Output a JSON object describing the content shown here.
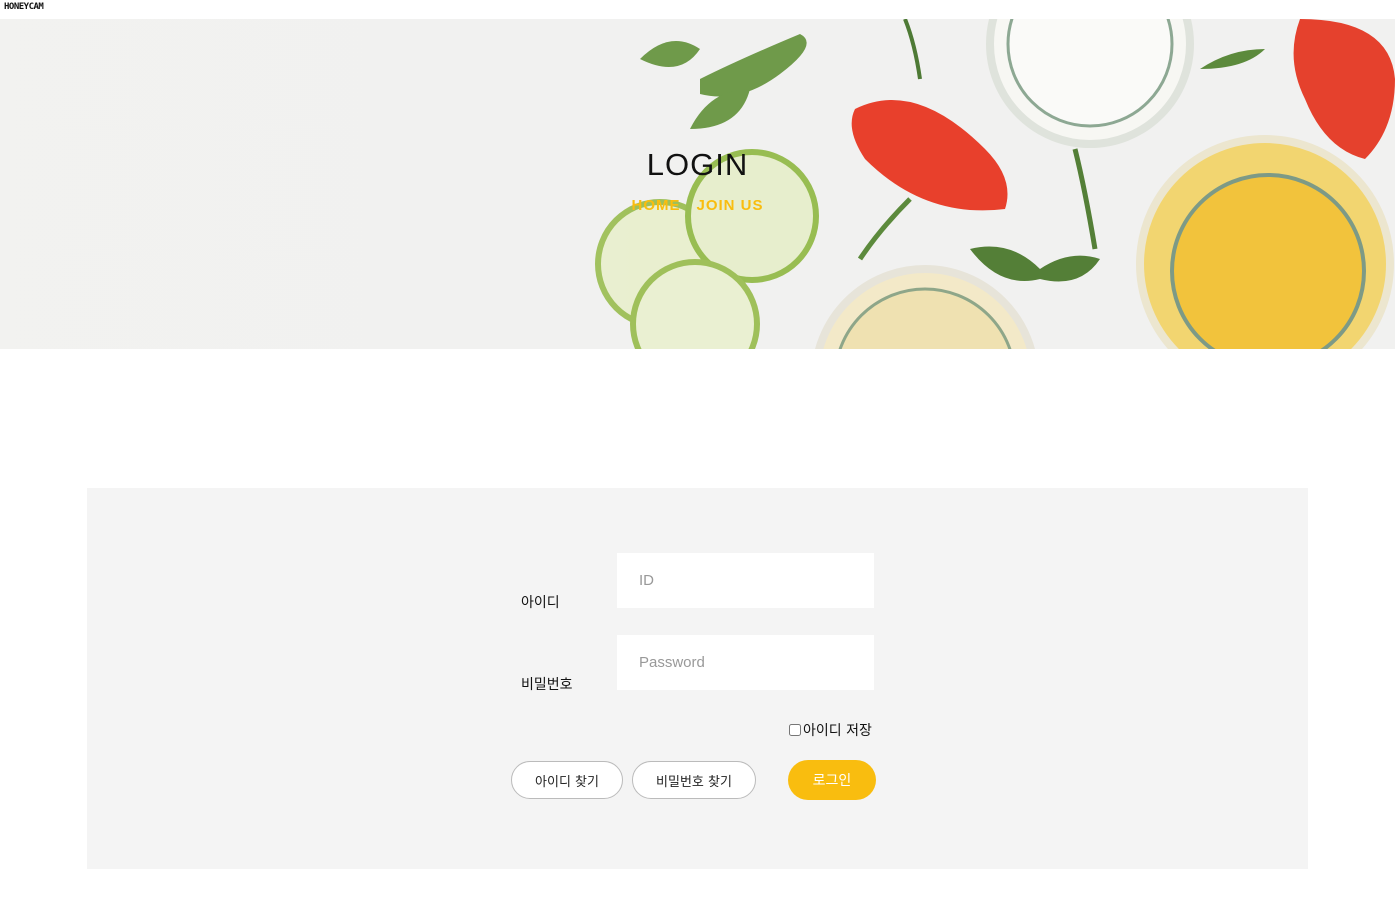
{
  "watermark": "HONEYCAM",
  "hero": {
    "title": "LOGIN",
    "breadcrumb": [
      "HOME",
      "JOIN US"
    ]
  },
  "form": {
    "id_label": "아이디",
    "id_placeholder": "ID",
    "pw_label": "비밀번호",
    "pw_placeholder": "Password",
    "remember_label": "아이디 저장",
    "remember_checked": false
  },
  "buttons": {
    "find_id": "아이디 찾기",
    "find_pw": "비밀번호 찾기",
    "login": "로그인"
  },
  "colors": {
    "accent": "#f9bd0f",
    "panel_bg": "#f4f4f4"
  }
}
